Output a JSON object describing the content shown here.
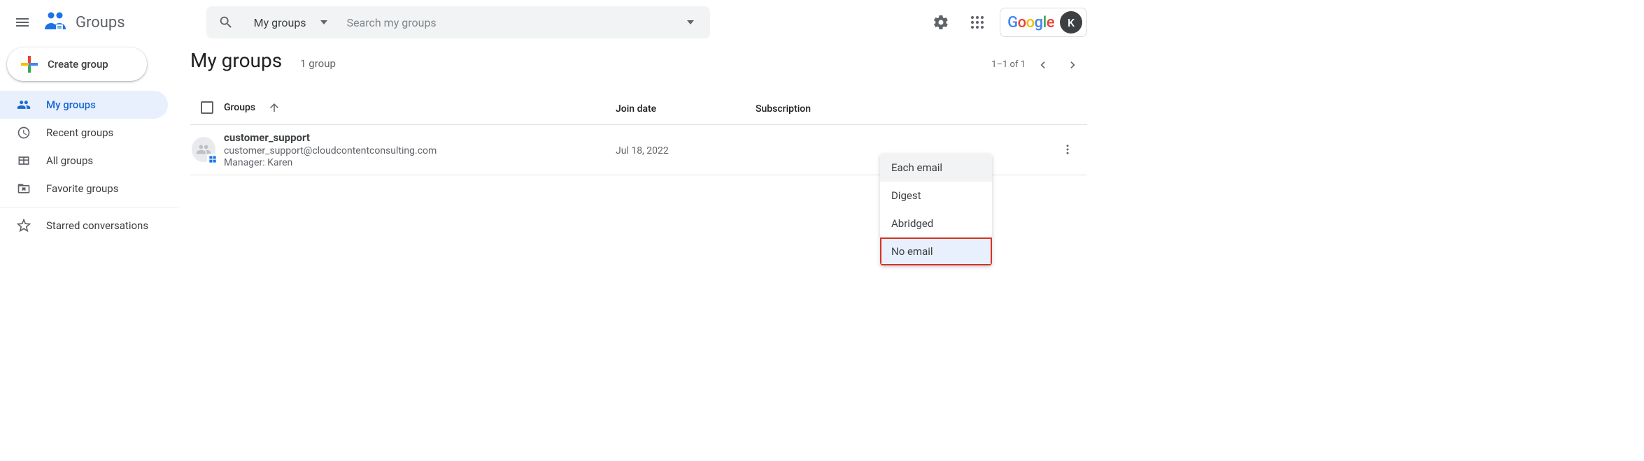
{
  "app_name": "Groups",
  "search": {
    "scope": "My groups",
    "placeholder": "Search my groups"
  },
  "user_initial": "K",
  "create_button_label": "Create group",
  "nav": [
    {
      "label": "My groups",
      "icon": "people"
    },
    {
      "label": "Recent groups",
      "icon": "clock"
    },
    {
      "label": "All groups",
      "icon": "table"
    },
    {
      "label": "Favorite groups",
      "icon": "bookmark-folder"
    },
    {
      "label": "Starred conversations",
      "icon": "star"
    }
  ],
  "page": {
    "title": "My groups",
    "count_text": "1 group",
    "range_text": "1–1 of 1"
  },
  "columns": {
    "groups": "Groups",
    "join": "Join date",
    "sub": "Subscription"
  },
  "rows": [
    {
      "name": "customer_support",
      "email": "customer_support@cloudcontentconsulting.com",
      "manager_line": "Manager: Karen",
      "join_date": "Jul 18, 2022"
    }
  ],
  "subscription_menu": {
    "options": [
      "Each email",
      "Digest",
      "Abridged",
      "No email"
    ],
    "hover_index": 0,
    "highlight_index": 3
  }
}
